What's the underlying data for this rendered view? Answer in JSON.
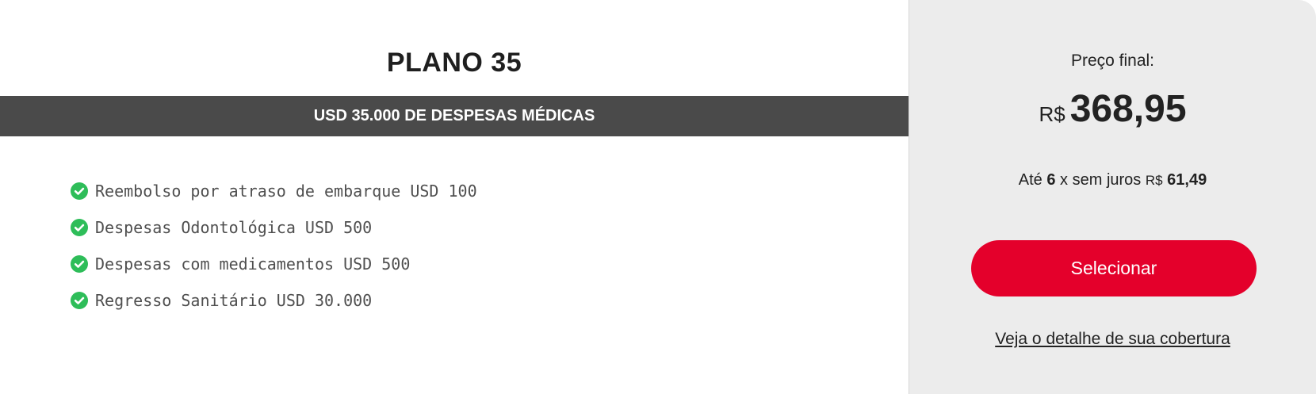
{
  "plan": {
    "title": "PLANO 35",
    "coverage": "USD 35.000 DE DESPESAS MÉDICAS",
    "benefits": [
      {
        "label": "Reembolso por atraso de embarque USD 100"
      },
      {
        "label": "Despesas Odontológica USD 500"
      },
      {
        "label": "Despesas com medicamentos USD 500"
      },
      {
        "label": "Regresso Sanitário USD 30.000"
      }
    ]
  },
  "pricing": {
    "label": "Preço final:",
    "currency": "R$",
    "amount": "368,95",
    "installments_prefix": "Até",
    "installments_count": "6",
    "installments_middle": "x sem juros",
    "installments_currency": "R$",
    "installments_value": "61,49",
    "select_label": "Selecionar",
    "detail_link": "Veja o detalhe de sua cobertura"
  },
  "colors": {
    "accent": "#e4002b",
    "check": "#2ebd59",
    "bar": "#4a4a4a",
    "panel": "#ececec"
  },
  "icons": {
    "benefit": "check-circle-icon"
  }
}
